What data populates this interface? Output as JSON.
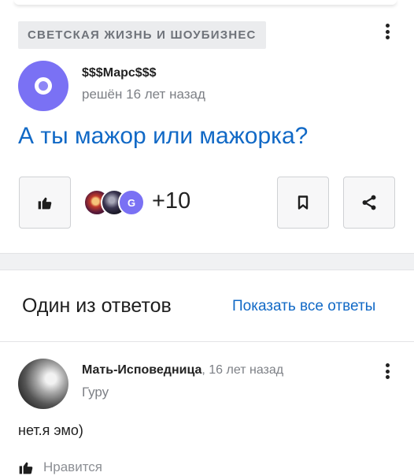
{
  "question": {
    "category": "СВЕТСКАЯ ЖИЗНЬ И ШОУБИЗНЕС",
    "author": "$$$Марс$$$",
    "status": "решён 16 лет назад",
    "title": "А ты мажор или мажорка?",
    "likers": [
      "liker-avatar-1",
      "liker-avatar-2",
      "G"
    ],
    "liker_extra": "+10"
  },
  "answers": {
    "heading": "Один из ответов",
    "show_all": "Показать все ответы",
    "answer": {
      "author": "Мать-Исповедница",
      "time": ", 16 лет назад",
      "rank": "Гуру",
      "text": "нет.я эмо)",
      "like_label": "Нравится"
    }
  },
  "icons": [
    "thumbs-up-icon",
    "bookmark-icon",
    "share-icon",
    "more-icon"
  ],
  "colors": {
    "link": "#1169c6",
    "avatar": "#7a71f4",
    "muted": "#7d8086"
  }
}
